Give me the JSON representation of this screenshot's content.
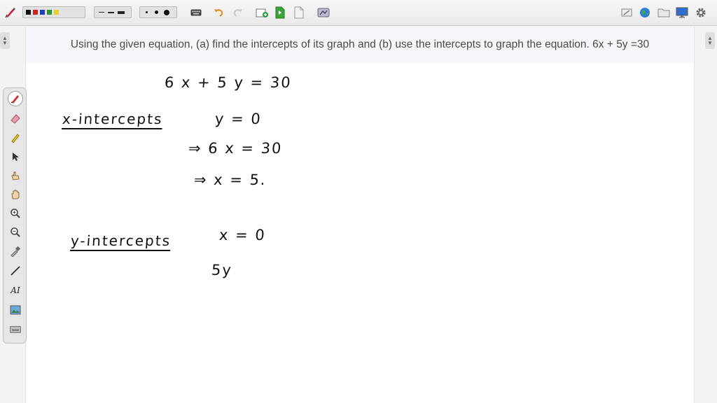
{
  "toolbar": {
    "colors": [
      "#111111",
      "#d42020",
      "#1f3fbf",
      "#1f9a2f",
      "#e6d21e"
    ],
    "tools": [
      "pen-menu-icon",
      "color-palette",
      "line-style-group",
      "pen-size-group",
      "keyboard-icon",
      "undo-icon",
      "redo-icon",
      "add-page-icon",
      "next-page-icon",
      "copy-page-icon",
      "share-icon",
      "clear-icon",
      "globe-icon",
      "folder-icon",
      "screen-icon",
      "settings-icon"
    ]
  },
  "question": {
    "text": "Using the given equation, (a) find the intercepts of its graph and (b) use the intercepts to graph the equation. 6x + 5y =30"
  },
  "notes": {
    "equation": "6 x + 5 y = 30",
    "x_heading": "x-intercepts",
    "x_step1": "y = 0",
    "x_step2": "⇒  6 x = 30",
    "x_step3": "⇒   x = 5.",
    "y_heading": "y-intercepts",
    "y_step1": "x = 0",
    "y_step2": "5y"
  },
  "sidebar": {
    "tools": [
      "pen-tool",
      "eraser-tool",
      "highlighter-tool",
      "select-tool",
      "pointer-hand-tool",
      "pan-hand-tool",
      "zoom-in-tool",
      "zoom-out-tool",
      "eyedropper-tool",
      "line-tool",
      "text-tool",
      "image-tool",
      "keyboard-tool"
    ],
    "text_tool_label": "AI"
  }
}
